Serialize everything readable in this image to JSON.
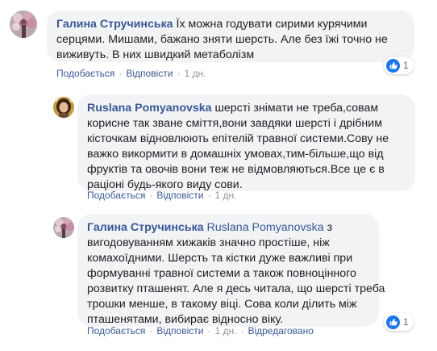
{
  "comments": [
    {
      "author": "Галина Стручинська",
      "mention": "",
      "text_lines": [
        "Їх можна годувати сирими курячими",
        "серцями. Мишами, бажано зняти шерсть. Але без їжі точно не",
        "виживуть. В них швидкий метаболізм"
      ],
      "text_first_line": "Їх можна годувати сирими курячими",
      "text_line_2": "серцями. Мишами, бажано зняти шерсть. Але без їжі точно не",
      "text_line_3": "виживуть. В них швидкий метаболізм",
      "reaction_count": "1",
      "actions": {
        "like": "Подобається",
        "reply": "Відповісти",
        "time": "1 дн.",
        "edited": ""
      }
    },
    {
      "author": "Ruslana Pomyanovska",
      "mention": "",
      "text_first_line": "шерсті знімати не треба,совам",
      "text_line_2": "корисне так зване сміття,вони завдяки шерсті і дрібним",
      "text_line_3": "кісточкам відновлюють епітелій травної системи.Сову не",
      "text_line_4": "важко викормити в домашніх умовах,тим-більше,що від",
      "text_line_5": "фруктів та овочів вони теж не відмовляються.Все це є в",
      "text_line_6": "раціоні будь-якого виду сови.",
      "reaction_count": "",
      "actions": {
        "like": "Подобається",
        "reply": "Відповісти",
        "time": "1 дн.",
        "edited": ""
      }
    },
    {
      "author": "Галина Стручинська",
      "mention": "Ruslana Pomyanovska",
      "text_first_line": "з",
      "text_line_2": "вигодовуванням хижаків значно простіше, ніж",
      "text_line_3": "комахоїдними. Шерсть та кістки дуже важливі при",
      "text_line_4": "формуванні травної системи а також повноцінного",
      "text_line_5": "розвитку пташенят. Але я десь читала, що шерсті треба",
      "text_line_6": "трошки менше, в такому віці. Сова коли ділить між",
      "text_line_7": "пташенятами, вибирає відносно віку.",
      "reaction_count": "1",
      "actions": {
        "like": "Подобається",
        "reply": "Відповісти",
        "time": "1 дн.",
        "edited": "Відредаговано"
      }
    }
  ],
  "separator": "·",
  "colors": {
    "link": "#385898",
    "bubble": "#f2f3f5",
    "like": "#1877f2",
    "meta": "#90949c"
  },
  "icons": {
    "like": "thumbs-up-icon"
  }
}
